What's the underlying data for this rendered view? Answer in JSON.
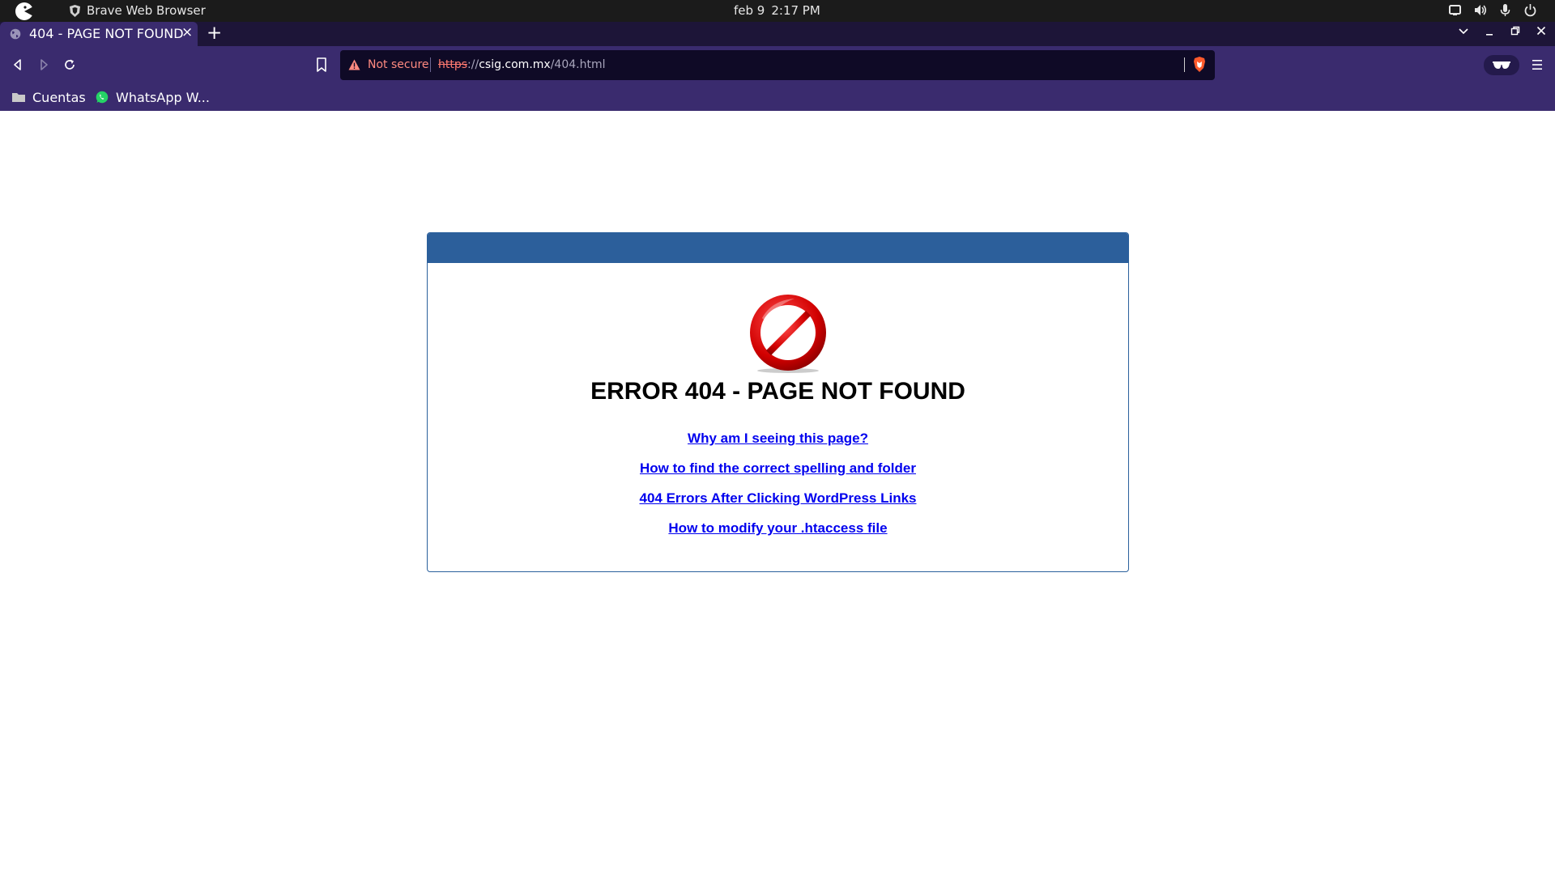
{
  "os_bar": {
    "app_name": "Brave Web Browser",
    "date": "feb 9",
    "time": "2:17 PM",
    "tray_icons": [
      "window-icon",
      "volume-icon",
      "microphone-icon",
      "power-icon"
    ]
  },
  "tabs": [
    {
      "title": "404 - PAGE NOT FOUND",
      "favicon": "globe-icon",
      "active": true
    }
  ],
  "tab_close": "×",
  "new_tab": "+",
  "toolbar": {
    "security_label": "Not secure",
    "url_scheme": "https",
    "url_separator": "://",
    "url_host": "csig.com.mx",
    "url_path": "/404.html"
  },
  "bookmarks": [
    {
      "label": "Cuentas",
      "icon": "folder-icon"
    },
    {
      "label": "WhatsApp W...",
      "icon": "whatsapp-icon"
    }
  ],
  "page": {
    "header_color": "#2c5f9b",
    "title": "ERROR 404 - PAGE NOT FOUND",
    "links": [
      "Why am I seeing this page?",
      "How to find the correct spelling and folder",
      "404 Errors After Clicking WordPress Links",
      "How to modify your .htaccess file"
    ]
  },
  "colors": {
    "browser_toolbar": "#3a2b6e",
    "tab_strip": "#1d1538",
    "link": "#0000ee",
    "not_secure": "#ff8a80"
  }
}
